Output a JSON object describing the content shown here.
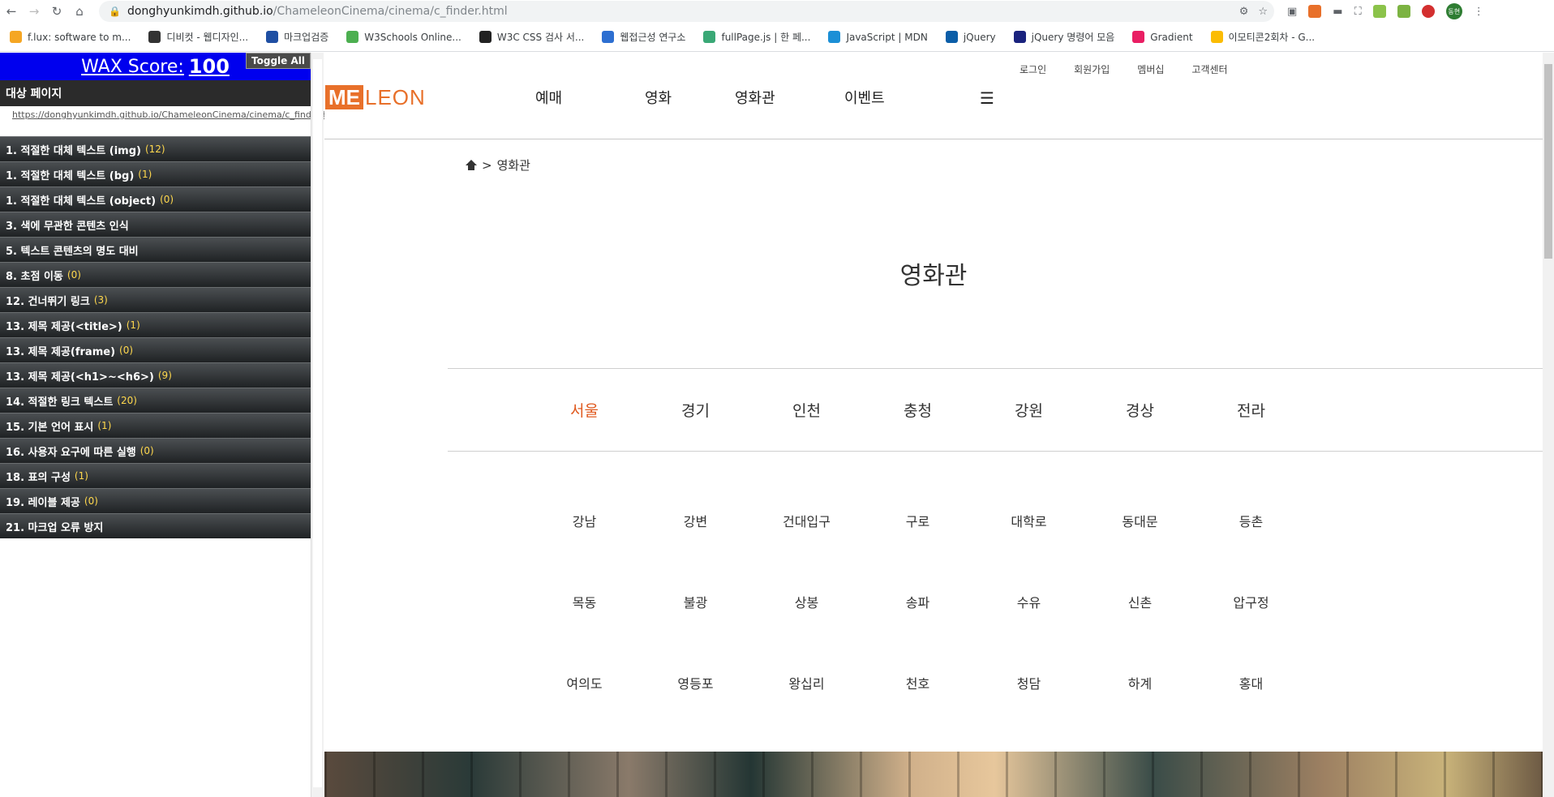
{
  "browser": {
    "url_host": "donghyunkimdh.github.io",
    "url_path": "/ChameleonCinema/cinema/c_finder.html",
    "profile_label": "동현",
    "bookmarks": [
      {
        "label": "f.lux: software to m...",
        "color": "#f5a623"
      },
      {
        "label": "디비컷 - 웹디자인...",
        "color": "#333333"
      },
      {
        "label": "마크업검증",
        "color": "#1f4fa3"
      },
      {
        "label": "W3Schools Online...",
        "color": "#4caf50"
      },
      {
        "label": "W3C CSS 검사 서...",
        "color": "#222222"
      },
      {
        "label": "웹접근성 연구소",
        "color": "#2d6fd1"
      },
      {
        "label": "fullPage.js | 한 페...",
        "color": "#3aa876"
      },
      {
        "label": "JavaScript | MDN",
        "color": "#1b8fd6"
      },
      {
        "label": "jQuery",
        "color": "#0b5ea8"
      },
      {
        "label": "jQuery 명령어 모음",
        "color": "#1a237e"
      },
      {
        "label": "Gradient",
        "color": "#e91e63"
      },
      {
        "label": "이모티콘2회차 - G...",
        "color": "#fbbc04"
      }
    ]
  },
  "wax": {
    "score_label": "WAX Score:",
    "score_value": "100",
    "toggle_all": "Toggle All",
    "target_heading": "대상 페이지",
    "target_url": "https://donghyunkimdh.github.io/ChameleonCinema/cinema/c_finder.html",
    "items": [
      {
        "label": "1. 적절한 대체 텍스트 (img)",
        "count": "(12)"
      },
      {
        "label": "1. 적절한 대체 텍스트 (bg)",
        "count": "(1)"
      },
      {
        "label": "1. 적절한 대체 텍스트 (object)",
        "count": "(0)"
      },
      {
        "label": "3. 색에 무관한 콘텐츠 인식",
        "count": ""
      },
      {
        "label": "5. 텍스트 콘텐츠의 명도 대비",
        "count": ""
      },
      {
        "label": "8. 초점 이동",
        "count": "(0)"
      },
      {
        "label": "12. 건너뛰기 링크",
        "count": "(3)"
      },
      {
        "label": "13. 제목 제공(<title>)",
        "count": "(1)"
      },
      {
        "label": "13. 제목 제공(frame)",
        "count": "(0)"
      },
      {
        "label": "13. 제목 제공(<h1>~<h6>)",
        "count": "(9)"
      },
      {
        "label": "14. 적절한 링크 텍스트",
        "count": "(20)"
      },
      {
        "label": "15. 기본 언어 표시",
        "count": "(1)"
      },
      {
        "label": "16. 사용자 요구에 따른 실행",
        "count": "(0)"
      },
      {
        "label": "18. 표의 구성",
        "count": "(1)"
      },
      {
        "label": "19. 레이블 제공",
        "count": "(0)"
      },
      {
        "label": "21. 마크업 오류 방지",
        "count": ""
      }
    ]
  },
  "site": {
    "logo_me": "ME",
    "logo_leon": "LEON",
    "util_links": [
      "로그인",
      "회원가입",
      "멤버십",
      "고객센터"
    ],
    "gnb": [
      "예매",
      "영화",
      "영화관",
      "이벤트"
    ],
    "menu_glyph": "☰",
    "breadcrumb_sep": ">",
    "breadcrumb_current": "영화관",
    "page_title": "영화관",
    "regions": [
      "서울",
      "경기",
      "인천",
      "충청",
      "강원",
      "경상",
      "전라"
    ],
    "active_region_color": "#e05a1f",
    "theaters": [
      "강남",
      "강변",
      "건대입구",
      "구로",
      "대학로",
      "동대문",
      "등촌",
      "목동",
      "불광",
      "상봉",
      "송파",
      "수유",
      "신촌",
      "압구정",
      "여의도",
      "영등포",
      "왕십리",
      "천호",
      "청담",
      "하계",
      "홍대"
    ]
  }
}
